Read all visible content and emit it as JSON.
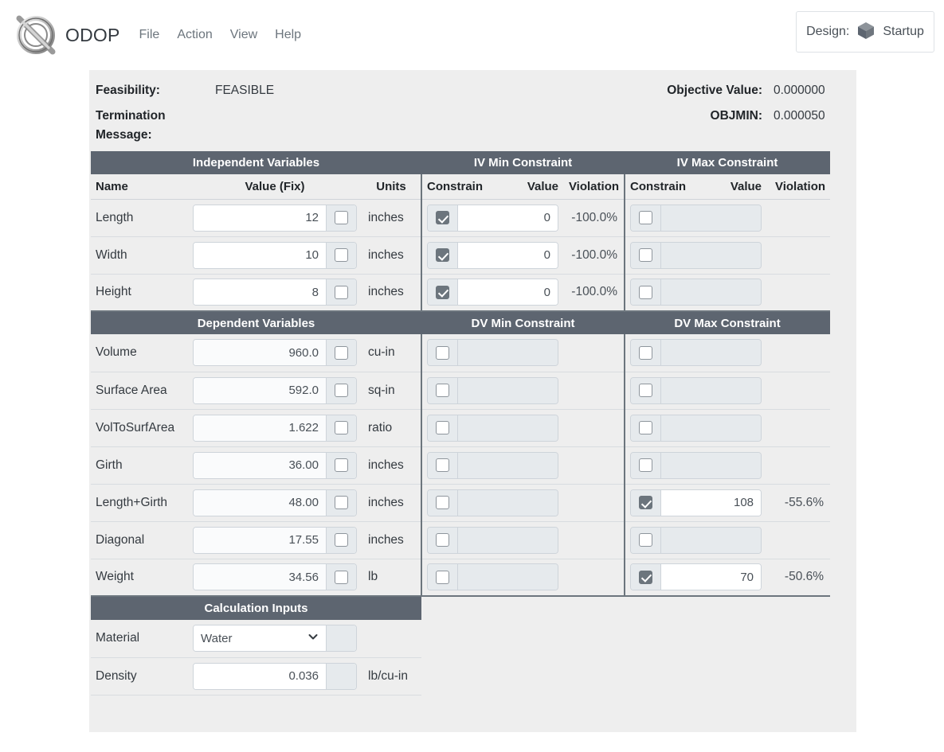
{
  "app": {
    "brand": "ODOP",
    "logo_icon": "circle-slash-logo",
    "menu": [
      {
        "label": "File"
      },
      {
        "label": "Action"
      },
      {
        "label": "View"
      },
      {
        "label": "Help"
      }
    ],
    "design": {
      "label": "Design:",
      "icon": "cube-icon",
      "value": "Startup"
    }
  },
  "status": {
    "feasibility_label": "Feasibility:",
    "feasibility_value": "FEASIBLE",
    "objective_label": "Objective Value:",
    "objective_value": "0.000000",
    "termination_label": "Termination Message:",
    "termination_value": "",
    "objmin_label": "OBJMIN:",
    "objmin_value": "0.000050"
  },
  "independent": {
    "section_titles": {
      "main": "Independent Variables",
      "min": "IV Min Constraint",
      "max": "IV Max Constraint"
    },
    "columns": {
      "name": "Name",
      "value": "Value (Fix)",
      "units": "Units",
      "min_constrain": "Constrain",
      "min_value": "Value",
      "min_violation": "Violation",
      "max_constrain": "Constrain",
      "max_value": "Value",
      "max_violation": "Violation"
    },
    "rows": [
      {
        "name": "Length",
        "value": "12",
        "fix": false,
        "units": "inches",
        "min_constrain": true,
        "min_value": "0",
        "min_violation": "-100.0%",
        "max_constrain": false,
        "max_value": "",
        "max_violation": ""
      },
      {
        "name": "Width",
        "value": "10",
        "fix": false,
        "units": "inches",
        "min_constrain": true,
        "min_value": "0",
        "min_violation": "-100.0%",
        "max_constrain": false,
        "max_value": "",
        "max_violation": ""
      },
      {
        "name": "Height",
        "value": "8",
        "fix": false,
        "units": "inches",
        "min_constrain": true,
        "min_value": "0",
        "min_violation": "-100.0%",
        "max_constrain": false,
        "max_value": "",
        "max_violation": ""
      }
    ]
  },
  "dependent": {
    "section_titles": {
      "main": "Dependent Variables",
      "min": "DV Min Constraint",
      "max": "DV Max Constraint"
    },
    "rows": [
      {
        "name": "Volume",
        "value": "960.0",
        "fix": false,
        "units": "cu-in",
        "min_constrain": false,
        "min_value": "",
        "min_violation": "",
        "max_constrain": false,
        "max_value": "",
        "max_violation": ""
      },
      {
        "name": "Surface Area",
        "value": "592.0",
        "fix": false,
        "units": "sq-in",
        "min_constrain": false,
        "min_value": "",
        "min_violation": "",
        "max_constrain": false,
        "max_value": "",
        "max_violation": ""
      },
      {
        "name": "VolToSurfArea",
        "value": "1.622",
        "fix": false,
        "units": "ratio",
        "min_constrain": false,
        "min_value": "",
        "min_violation": "",
        "max_constrain": false,
        "max_value": "",
        "max_violation": ""
      },
      {
        "name": "Girth",
        "value": "36.00",
        "fix": false,
        "units": "inches",
        "min_constrain": false,
        "min_value": "",
        "min_violation": "",
        "max_constrain": false,
        "max_value": "",
        "max_violation": ""
      },
      {
        "name": "Length+Girth",
        "value": "48.00",
        "fix": false,
        "units": "inches",
        "min_constrain": false,
        "min_value": "",
        "min_violation": "",
        "max_constrain": true,
        "max_value": "108",
        "max_violation": "-55.6%"
      },
      {
        "name": "Diagonal",
        "value": "17.55",
        "fix": false,
        "units": "inches",
        "min_constrain": false,
        "min_value": "",
        "min_violation": "",
        "max_constrain": false,
        "max_value": "",
        "max_violation": ""
      },
      {
        "name": "Weight",
        "value": "34.56",
        "fix": false,
        "units": "lb",
        "min_constrain": false,
        "min_value": "",
        "min_violation": "",
        "max_constrain": true,
        "max_value": "70",
        "max_violation": "-50.6%"
      }
    ]
  },
  "calculation_inputs": {
    "section_title": "Calculation Inputs",
    "rows": [
      {
        "name": "Material",
        "type": "select",
        "value": "Water",
        "options": [
          "Water"
        ],
        "units": "",
        "icon": "chevron-down-icon"
      },
      {
        "name": "Density",
        "type": "text",
        "value": "0.036",
        "units": "lb/cu-in"
      }
    ]
  },
  "colors": {
    "section_header_bg": "#5d6570",
    "panel_bg": "#eeeeee",
    "checked_box": "#6c757d",
    "disabled_field": "#e6eaed"
  }
}
